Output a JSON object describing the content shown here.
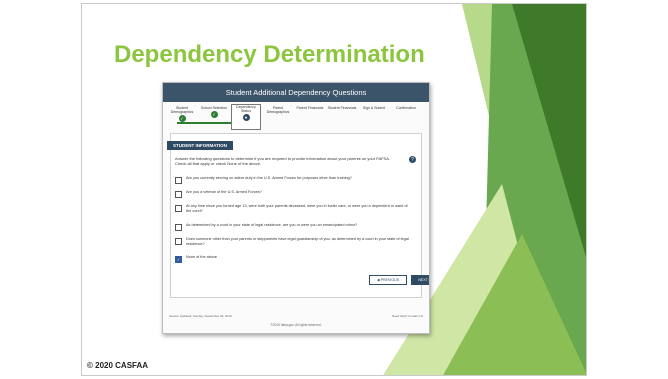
{
  "slide": {
    "title": "Dependency Determination",
    "footer": "© 2020 CASFAA",
    "colors": {
      "title": "#8cc63f",
      "deco_dark": "#3f7a2a",
      "deco_mid": "#6aa84f",
      "deco_light": "#b6d98a"
    }
  },
  "screen": {
    "header": "Student Additional Dependency Questions",
    "steps": [
      {
        "label": "Student Demographics",
        "state": "done"
      },
      {
        "label": "School Selection",
        "state": "done"
      },
      {
        "label": "Dependency Status",
        "state": "current"
      },
      {
        "label": "Parent Demographics",
        "state": "todo"
      },
      {
        "label": "Parent Financials",
        "state": "todo"
      },
      {
        "label": "Student Financials",
        "state": "todo"
      },
      {
        "label": "Sign & Submit",
        "state": "todo"
      },
      {
        "label": "Confirmation",
        "state": "todo"
      }
    ],
    "section_tab": "STUDENT INFORMATION",
    "intro": "Answer the following questions to determine if you are required to provide information about your parents on your FAFSA. Check all that apply or check None of the above.",
    "questions": [
      {
        "text": "Are you currently serving on active duty in the U.S. Armed Forces for purposes other than training?",
        "checked": false
      },
      {
        "text": "Are you a veteran of the U.S. Armed Forces?",
        "checked": false
      },
      {
        "text": "At any time since you turned age 13, were both your parents deceased, were you in foster care, or were you a dependent or ward of the court?",
        "checked": false
      },
      {
        "text": "As determined by a court in your state of legal residence, are you or were you an emancipated minor?",
        "checked": false
      },
      {
        "text": "Does someone other than your parents or stepparents have legal guardianship of you, as determined by a court in your state of legal residence?",
        "checked": false
      },
      {
        "text": "None of the above",
        "checked": true
      }
    ],
    "previous_label": "PREVIOUS",
    "next_label": "NEXT",
    "meta_left": "Section Updated: Sunday, September 29, 2019",
    "meta_right": "Need help? Contact Us",
    "meta_center": "©2019 fafsa.gov. All rights reserved."
  }
}
